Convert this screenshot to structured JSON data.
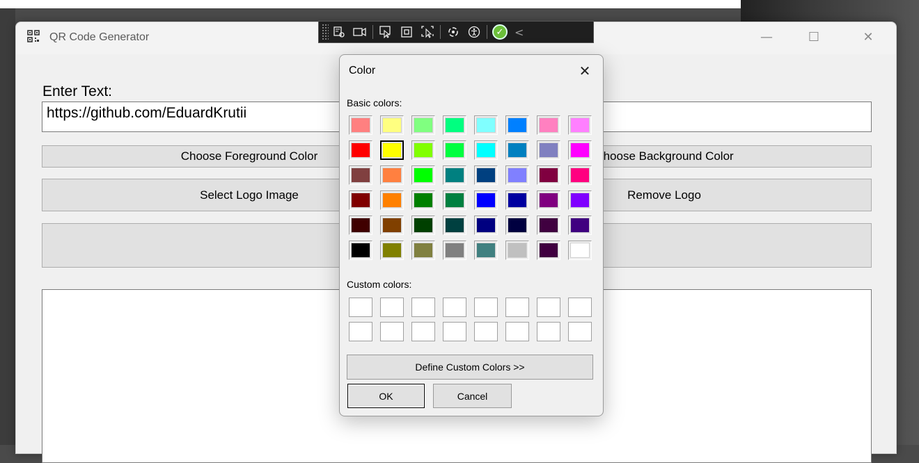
{
  "app": {
    "title": "QR Code Generator",
    "icon": "qr-code-icon",
    "controls": {
      "minimize": "—",
      "maximize": "☐",
      "close": "✕"
    }
  },
  "form": {
    "enter_text_label": "Enter Text:",
    "text_value": "https://github.com/EduardKrutii",
    "foreground_button": "Choose Foreground Color",
    "background_button": "Choose Background Color",
    "select_logo_button": "Select Logo Image",
    "remove_logo_button": "Remove Logo",
    "generate_button": ""
  },
  "toolbar": {
    "icons": [
      "live-visual-tree-icon",
      "record-icon",
      "select-element-icon",
      "display-layout-adorners-icon",
      "track-focus-icon",
      "hot-reload-icon",
      "accessibility-icon",
      "binding-check-icon",
      "collapse-icon"
    ]
  },
  "color_dialog": {
    "title": "Color",
    "close_glyph": "✕",
    "basic_label": "Basic colors:",
    "custom_label": "Custom colors:",
    "define_button": "Define Custom Colors >>",
    "ok_button": "OK",
    "cancel_button": "Cancel",
    "selected_index": 9,
    "basic_colors": [
      "#ff8080",
      "#ffff80",
      "#80ff80",
      "#00ff80",
      "#80ffff",
      "#0080ff",
      "#ff80c0",
      "#ff80ff",
      "#ff0000",
      "#ffff00",
      "#80ff00",
      "#00ff40",
      "#00ffff",
      "#0080c0",
      "#8080c0",
      "#ff00ff",
      "#804040",
      "#ff8040",
      "#00ff00",
      "#008080",
      "#004080",
      "#8080ff",
      "#800040",
      "#ff0080",
      "#800000",
      "#ff8000",
      "#008000",
      "#008040",
      "#0000ff",
      "#0000a0",
      "#800080",
      "#8000ff",
      "#400000",
      "#804000",
      "#004000",
      "#004040",
      "#000080",
      "#000040",
      "#400040",
      "#400080",
      "#000000",
      "#808000",
      "#808040",
      "#808080",
      "#408080",
      "#c0c0c0",
      "#400040",
      "#ffffff"
    ],
    "custom_colors": [
      "#ffffff",
      "#ffffff",
      "#ffffff",
      "#ffffff",
      "#ffffff",
      "#ffffff",
      "#ffffff",
      "#ffffff",
      "#ffffff",
      "#ffffff",
      "#ffffff",
      "#ffffff",
      "#ffffff",
      "#ffffff",
      "#ffffff",
      "#ffffff"
    ]
  }
}
